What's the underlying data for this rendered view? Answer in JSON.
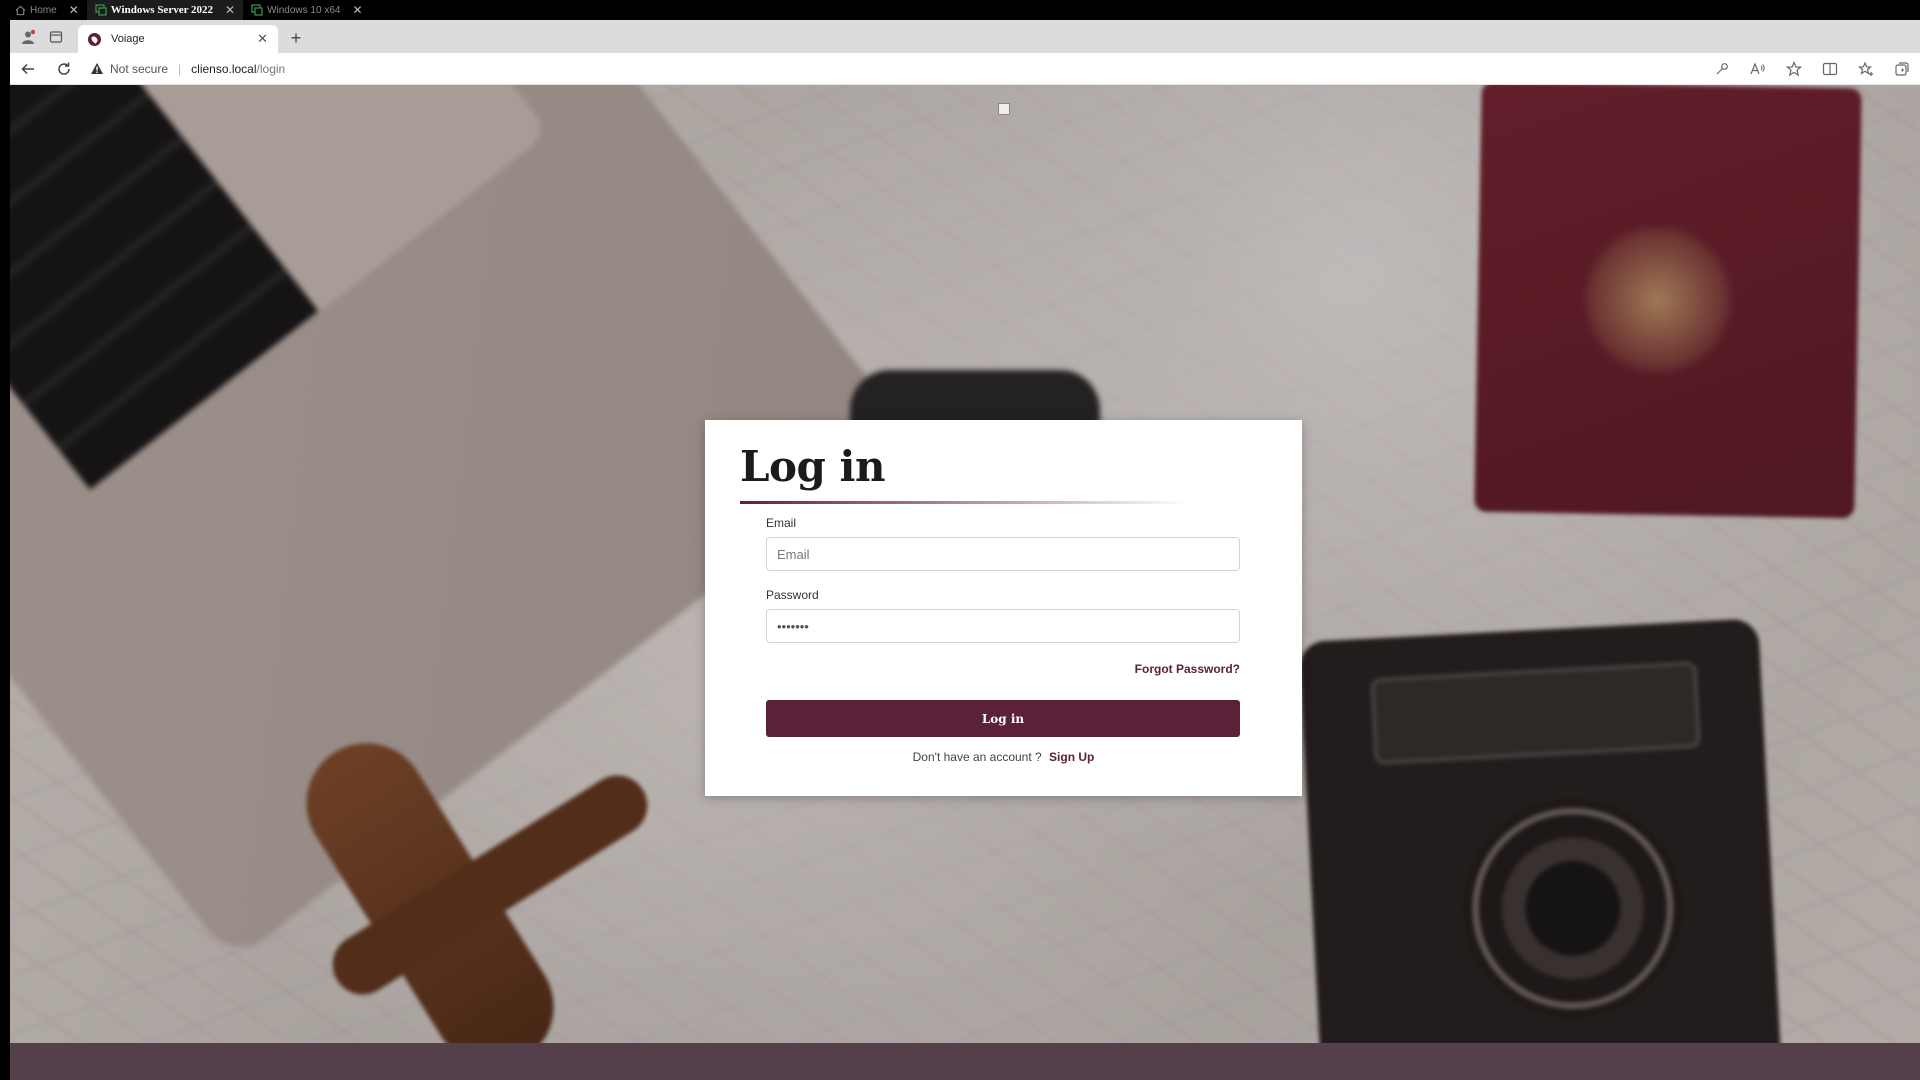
{
  "vm_tabs": [
    {
      "label": "Home",
      "icon": "home-icon"
    },
    {
      "label": "Windows Server 2022",
      "icon": "vm-icon"
    },
    {
      "label": "Windows 10 x64",
      "icon": "vm-icon"
    }
  ],
  "browser": {
    "tab_title": "Voiage",
    "security_label": "Not secure",
    "url_host": "clienso.local",
    "url_path": "/login"
  },
  "login": {
    "title": "Log in",
    "email_label": "Email",
    "email_placeholder": "Email",
    "password_label": "Password",
    "password_value": "•••••••",
    "forgot_label": "Forgot Password?",
    "submit_label": "Log in",
    "signup_prompt": "Don't have an account ?",
    "signup_link": "Sign Up"
  },
  "colors": {
    "brand": "#5b2138",
    "footer": "#53404b"
  }
}
